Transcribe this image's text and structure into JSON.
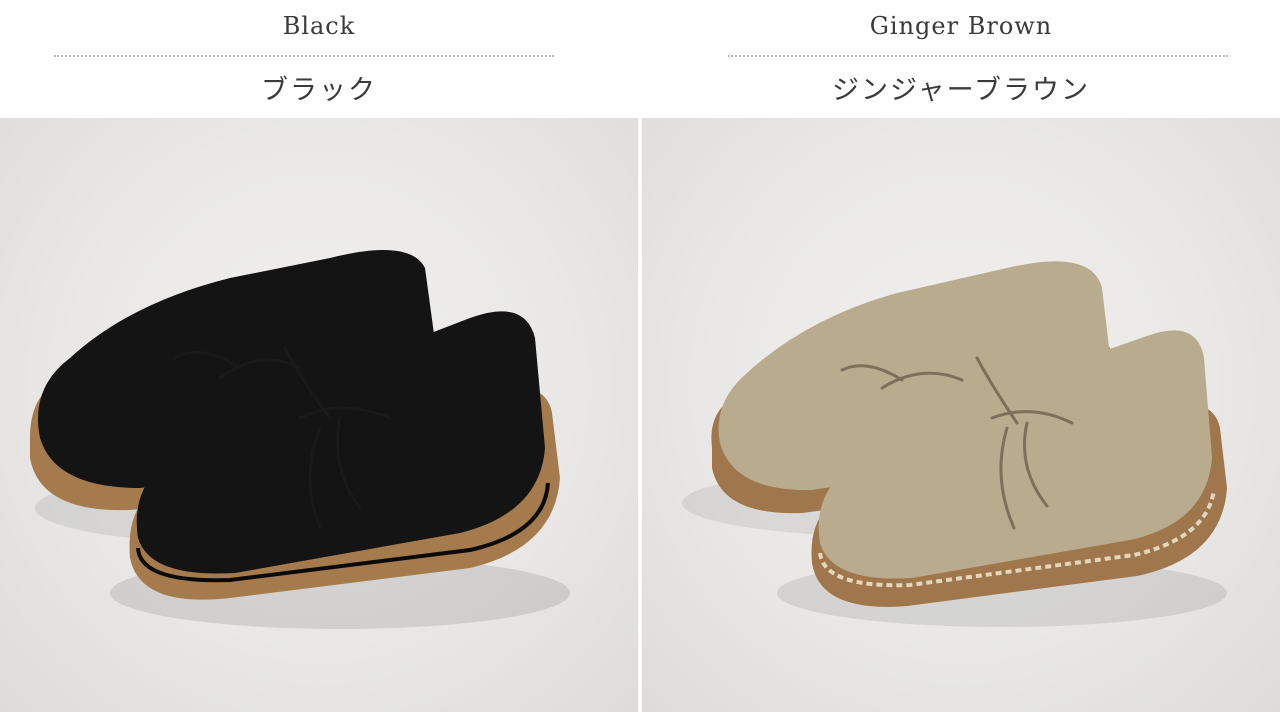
{
  "variants": [
    {
      "name_en": "Black",
      "name_ja": "ブラック",
      "upper_color": "#141414",
      "sole_color": "#a57a4d",
      "lace_color": "#1a1a1a"
    },
    {
      "name_en": "Ginger Brown",
      "name_ja": "ジンジャーブラウン",
      "upper_color": "#b9ab8e",
      "sole_color": "#a0774c",
      "lace_color": "#7d6f5c"
    }
  ]
}
